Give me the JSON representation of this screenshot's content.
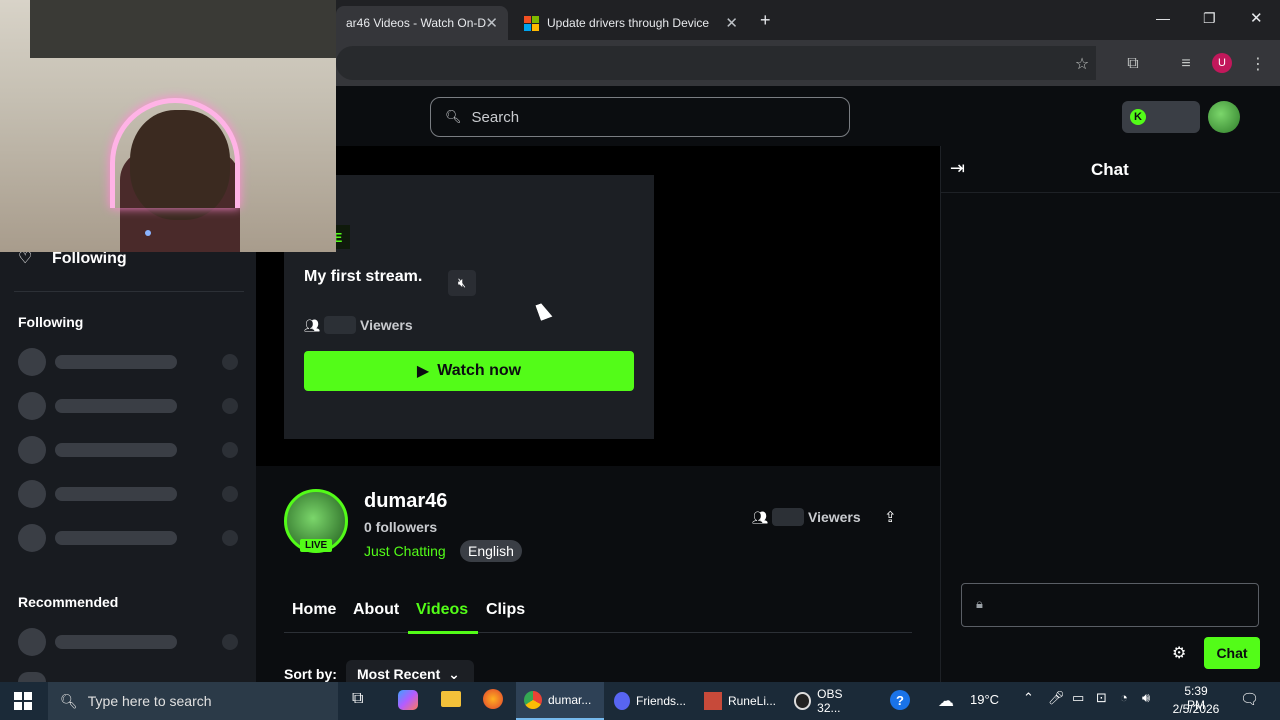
{
  "browser": {
    "tabs": [
      {
        "title": "ar46 Videos - Watch On-De",
        "active": true
      },
      {
        "title": "Update drivers through Device",
        "active": false
      }
    ],
    "new_tab": "+",
    "profile_initial": "U"
  },
  "site": {
    "search_placeholder": "Search",
    "following_nav": "Following",
    "sidebar": {
      "following_heading": "Following",
      "recommended_heading": "Recommended"
    },
    "player": {
      "live_fragment": "E",
      "stream_title": "My first stream.",
      "viewers_label": "Viewers",
      "watch_now": "Watch now"
    },
    "channel": {
      "name": "dumar46",
      "followers": "0 followers",
      "category": "Just Chatting",
      "language": "English",
      "live_badge": "LIVE",
      "viewers_label": "Viewers"
    },
    "tabs": [
      "Home",
      "About",
      "Videos",
      "Clips"
    ],
    "active_tab": "Videos",
    "sort_label": "Sort by:",
    "sort_value": "Most Recent",
    "chat": {
      "title": "Chat",
      "send_button": "Chat"
    }
  },
  "taskbar": {
    "search_placeholder": "Type here to search",
    "apps": [
      {
        "label": "dumar..."
      },
      {
        "label": "Friends..."
      },
      {
        "label": "RuneLi..."
      },
      {
        "label": "OBS 32..."
      }
    ],
    "weather": "19°C",
    "time": "5:39 PM",
    "date": "2/5/2026"
  },
  "colors": {
    "accent": "#53fc18",
    "background": "#0b0d10",
    "sidebar": "#181b20"
  }
}
